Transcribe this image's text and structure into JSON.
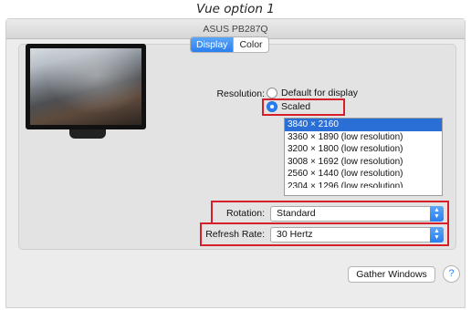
{
  "caption": "Vue option 1",
  "window": {
    "title": "ASUS PB287Q"
  },
  "tabs": [
    {
      "label": "Display",
      "active": true
    },
    {
      "label": "Color",
      "active": false
    }
  ],
  "resolution": {
    "label": "Resolution:",
    "option_default": "Default for display",
    "option_scaled": "Scaled",
    "selected": "Scaled",
    "list": [
      "3840 × 2160",
      "3360 × 1890 (low resolution)",
      "3200 × 1800 (low resolution)",
      "3008 × 1692 (low resolution)",
      "2560 × 1440 (low resolution)",
      "2304 × 1296 (low resolution)"
    ],
    "list_selected": "3840 × 2160"
  },
  "rotation": {
    "label": "Rotation:",
    "value": "Standard"
  },
  "refresh_rate": {
    "label": "Refresh Rate:",
    "value": "30 Hertz"
  },
  "footer": {
    "gather_windows": "Gather Windows",
    "help": "?"
  },
  "colors": {
    "accent": "#2a7ff0",
    "highlight_box": "#d51f2a",
    "window_bg": "#ececec"
  },
  "icons": {
    "help": "help-icon",
    "popup_arrows": "chevron-updown-icon",
    "display_preview": "monitor-icon"
  }
}
